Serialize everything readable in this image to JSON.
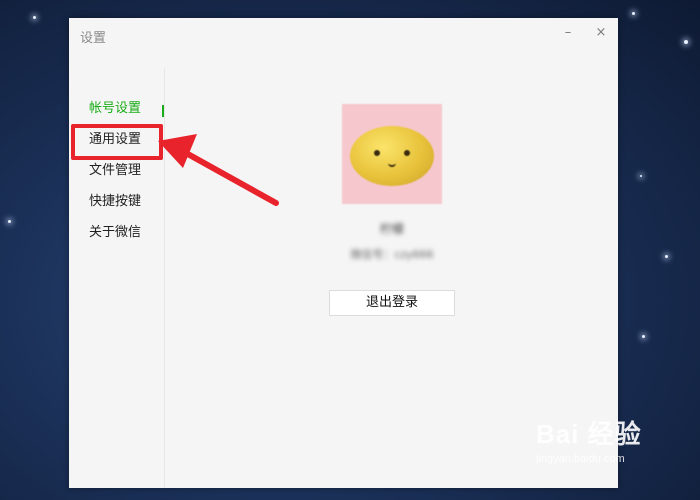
{
  "window": {
    "title": "设置",
    "minimize_glyph": "–",
    "close_glyph": "×"
  },
  "sidebar": {
    "items": [
      {
        "label": "帐号设置",
        "active": true
      },
      {
        "label": "通用设置",
        "active": false
      },
      {
        "label": "文件管理",
        "active": false
      },
      {
        "label": "快捷按键",
        "active": false
      },
      {
        "label": "关于微信",
        "active": false
      }
    ]
  },
  "account": {
    "nickname": "柠檬",
    "wechat_id": "微信号：czy666",
    "logout_label": "退出登录"
  },
  "colors": {
    "accent_green": "#1aad19",
    "annotation_red": "#e8232b"
  },
  "watermark": {
    "brand": "Bai 经验",
    "url": "jingyan.baidu.com"
  }
}
